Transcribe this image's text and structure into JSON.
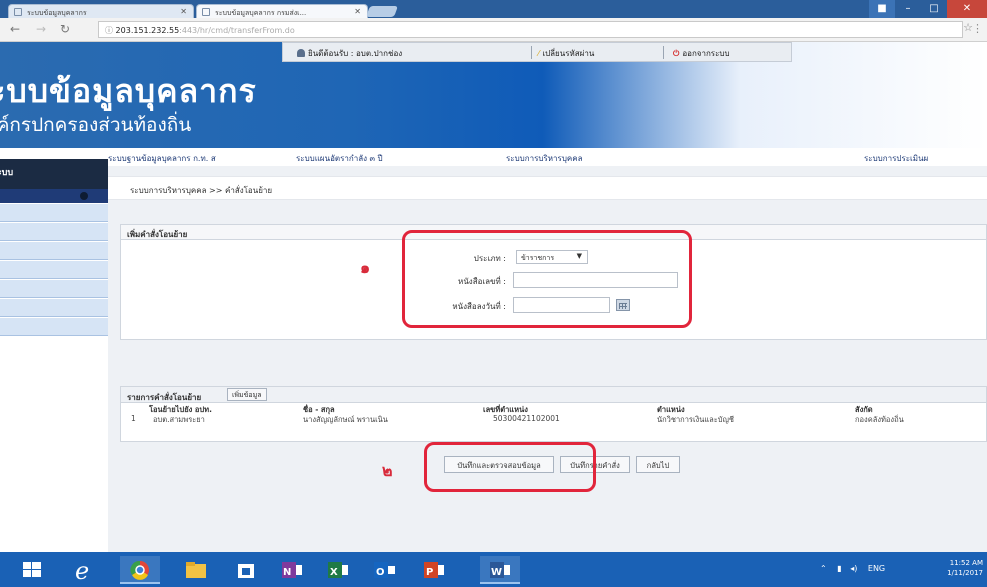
{
  "browser": {
    "tabs": [
      {
        "label": "ระบบข้อมูลบุคลากร"
      },
      {
        "label": "ระบบข้อมูลบุคลากร กรมส่งเ..."
      }
    ],
    "url_host": "203.151.232.55",
    "url_path": ":443/hr/cmd/transferFrom.do",
    "icons": [
      "back-arrow-icon",
      "forward-arrow-icon",
      "reload-icon",
      "info-icon",
      "star-icon",
      "menu-icon"
    ]
  },
  "header": {
    "title": "ระบบข้อมูลบุคลากร",
    "subtitle": "องค์กรปกครองส่วนท้องถิ่น",
    "user_label": "ยินดีต้อนรับ : อบต.ปากช่อง",
    "change_password": "เปลี่ยนรหัสผ่าน",
    "logout": "ออกจากระบบ"
  },
  "nav": {
    "items": [
      "ระบบฐานข้อมูลบุคลากร ก.ท. ส",
      "ระบบแผนอัตรากำลัง ๓ ปี",
      "ระบบการบริหารบุคคล",
      "ระบบการประเมินผ"
    ]
  },
  "sidebar": {
    "heading": "ระบบ"
  },
  "breadcrumb": "ระบบการบริหารบุคคล >> คำสั่งโอนย้าย",
  "form": {
    "section_title": "เพิ่มคำสั่งโอนย้าย",
    "type_label": "ประเภท :",
    "type_value": "ข้าราชการ",
    "doc_no_label": "หนังสือเลขที่ :",
    "doc_no_value": "",
    "doc_date_label": "หนังสือลงวันที่ :",
    "doc_date_value": ""
  },
  "list": {
    "section_title": "รายการคำสั่งโอนย้าย",
    "add_button": "เพิ่มข้อมูล",
    "columns": [
      "โอนย้ายไปยัง อปท.",
      "ชื่อ - สกุล",
      "เลขที่ตำแหน่ง",
      "ตำแหน่ง",
      "สังกัด"
    ],
    "rows": [
      {
        "no": "1",
        "dest": "อบต.สามพระยา",
        "name": "นางสัญญลักษณ์ พรานเนิน",
        "position_no": "50300421102001",
        "position": "นักวิชาการเงินและบัญชี",
        "department": "กองคลังท้องถิ่น"
      }
    ]
  },
  "actions": {
    "save_verify": "บันทึกและตรวจสอบข้อมูล",
    "save_order": "บันทึกรายคำสั่ง",
    "back": "กลับไป"
  },
  "annotations": {
    "marker_1": "๑",
    "marker_2": "๒",
    "color": "#e1253b"
  },
  "taskbar": {
    "apps": [
      "windows-start-icon",
      "internet-explorer-icon",
      "chrome-icon",
      "file-explorer-icon",
      "store-icon",
      "onenote-icon",
      "excel-icon",
      "outlook-icon",
      "powerpoint-icon",
      "word-icon"
    ],
    "time": "11:52 AM",
    "date": "1/11/2017",
    "lang": "ENG"
  }
}
